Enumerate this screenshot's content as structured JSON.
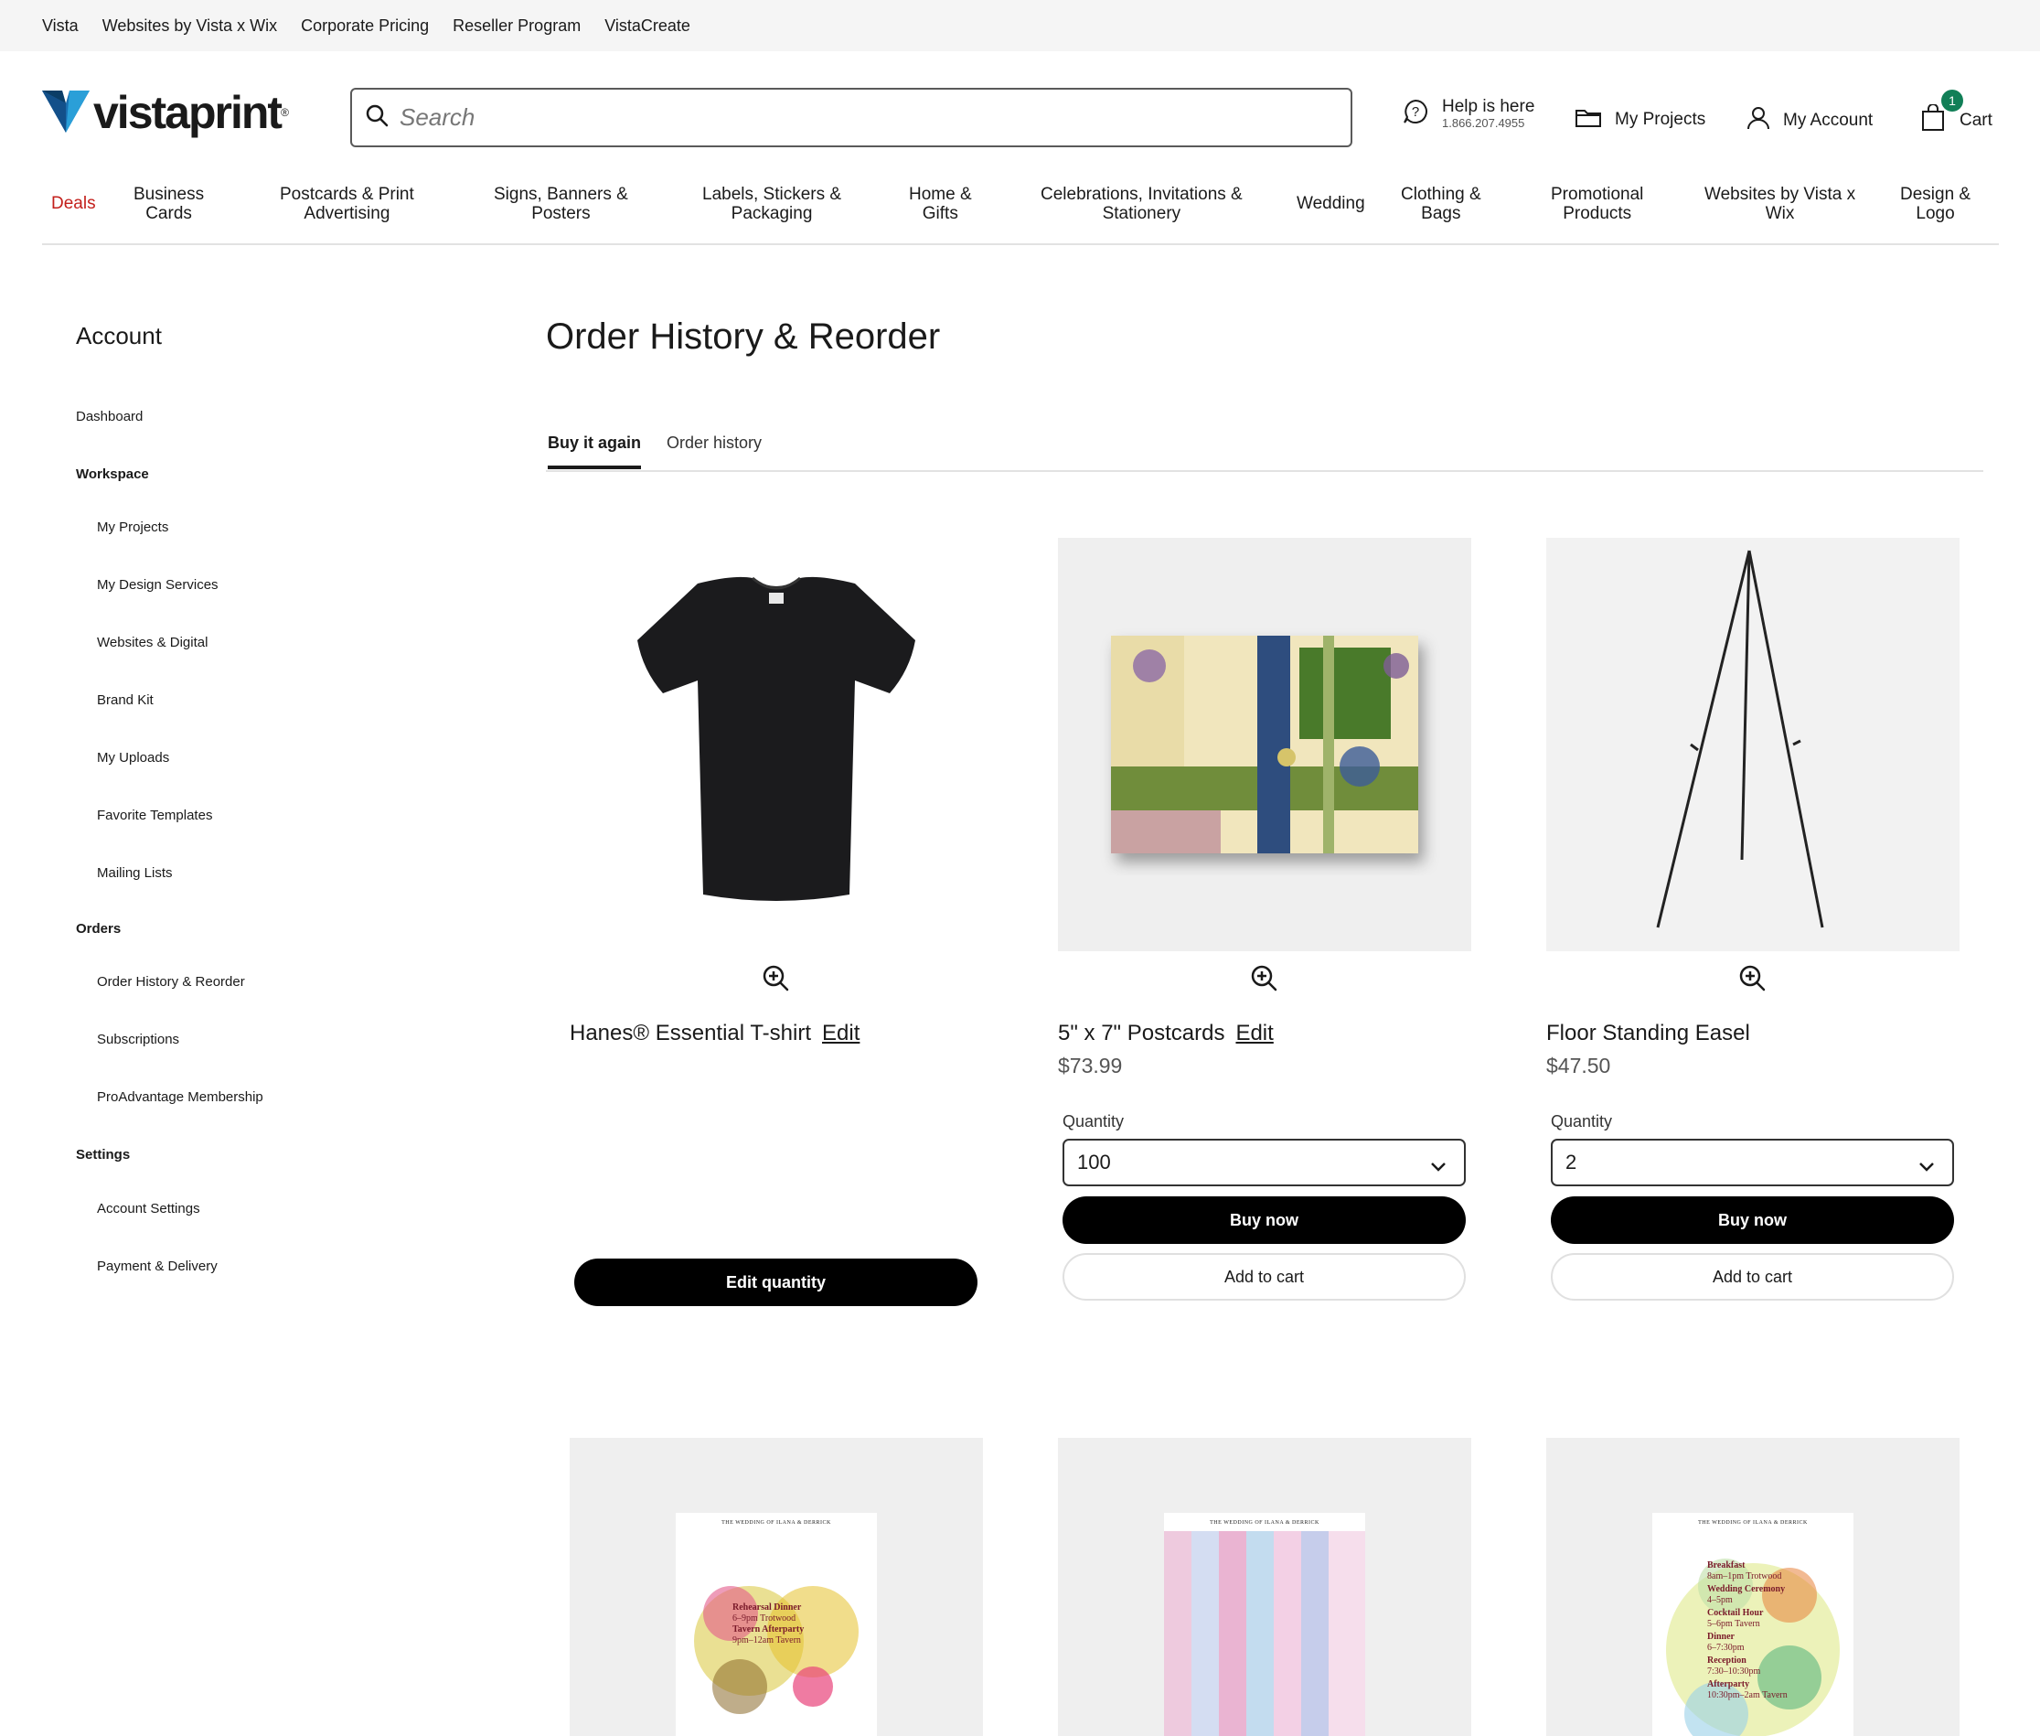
{
  "utility_links": [
    "Vista",
    "Websites by Vista x Wix",
    "Corporate Pricing",
    "Reseller Program",
    "VistaCreate"
  ],
  "header": {
    "logo_text": "vistaprint",
    "search_placeholder": "Search",
    "help_title": "Help is here",
    "help_phone": "1.866.207.4955",
    "projects_label": "My Projects",
    "account_label": "My Account",
    "cart_label": "Cart",
    "cart_count": "1",
    "brand_color": "#117f57",
    "deals_color": "#c3201c"
  },
  "categories": [
    {
      "line1": "Deals",
      "line2": ""
    },
    {
      "line1": "Business",
      "line2": "Cards"
    },
    {
      "line1": "Postcards & Print",
      "line2": "Advertising"
    },
    {
      "line1": "Signs, Banners &",
      "line2": "Posters"
    },
    {
      "line1": "Labels, Stickers &",
      "line2": "Packaging"
    },
    {
      "line1": "Home &",
      "line2": "Gifts"
    },
    {
      "line1": "Celebrations, Invitations &",
      "line2": "Stationery"
    },
    {
      "line1": "Wedding",
      "line2": ""
    },
    {
      "line1": "Clothing &",
      "line2": "Bags"
    },
    {
      "line1": "Promotional",
      "line2": "Products"
    },
    {
      "line1": "Websites by Vista x",
      "line2": "Wix"
    },
    {
      "line1": "Design &",
      "line2": "Logo"
    }
  ],
  "sidebar": {
    "title": "Account",
    "dashboard": "Dashboard",
    "workspace": "Workspace",
    "workspace_items": [
      "My Projects",
      "My Design Services",
      "Websites & Digital",
      "Brand Kit",
      "My Uploads",
      "Favorite Templates",
      "Mailing Lists"
    ],
    "orders": "Orders",
    "orders_items": [
      "Order History & Reorder",
      "Subscriptions",
      "ProAdvantage Membership"
    ],
    "settings": "Settings",
    "settings_items": [
      "Account Settings",
      "Payment & Delivery"
    ]
  },
  "main": {
    "title": "Order History & Reorder",
    "tabs": [
      "Buy it again",
      "Order history"
    ],
    "products": [
      {
        "name": "Hanes® Essential T-shirt",
        "edit": "Edit",
        "price": "",
        "button": "Edit quantity"
      },
      {
        "name": "5\" x 7\" Postcards",
        "edit": "Edit",
        "price": "$73.99",
        "quantity_label": "Quantity",
        "quantity": "100",
        "buy": "Buy now",
        "cart": "Add to cart"
      },
      {
        "name": "Floor Standing Easel",
        "edit": "",
        "price": "$47.50",
        "quantity_label": "Quantity",
        "quantity": "2",
        "buy": "Buy now",
        "cart": "Add to cart"
      }
    ],
    "sign_cards": [
      {
        "header": "THE WEDDING OF ILANA & DERRICK",
        "lines": [
          "Rehearsal Dinner",
          "6–9pm Trotwood",
          "Tavern Afterparty",
          "9pm–12am Tavern"
        ]
      },
      {
        "header": "THE WEDDING OF ILANA & DERRICK",
        "lines": []
      },
      {
        "header": "THE WEDDING OF ILANA & DERRICK",
        "lines": [
          "Breakfast",
          "8am–1pm Trotwood",
          "Wedding Ceremony",
          "4–5pm",
          "Cocktail Hour",
          "5–6pm Tavern",
          "Dinner",
          "6–7:30pm",
          "Reception",
          "7:30–10:30pm",
          "Afterparty",
          "10:30pm–2am Tavern"
        ]
      }
    ]
  }
}
